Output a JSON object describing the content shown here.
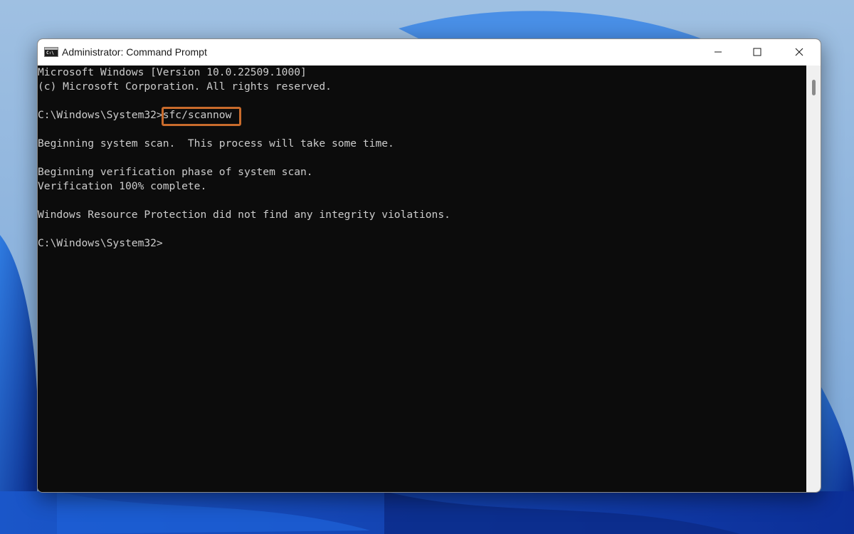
{
  "window": {
    "title": "Administrator: Command Prompt",
    "icon": "cmd-icon",
    "controls": {
      "minimize": "minimize-icon",
      "maximize": "maximize-icon",
      "close": "close-icon"
    }
  },
  "console": {
    "lines": [
      "Microsoft Windows [Version 10.0.22509.1000]",
      "(c) Microsoft Corporation. All rights reserved.",
      "",
      "C:\\Windows\\System32>sfc/scannow",
      "",
      "Beginning system scan.  This process will take some time.",
      "",
      "Beginning verification phase of system scan.",
      "Verification 100% complete.",
      "",
      "Windows Resource Protection did not find any integrity violations.",
      "",
      "C:\\Windows\\System32>"
    ],
    "highlighted_command": "sfc/scannow",
    "highlight_color": "#c96b2c",
    "background_color": "#0c0c0c",
    "text_color": "#cccccc"
  }
}
